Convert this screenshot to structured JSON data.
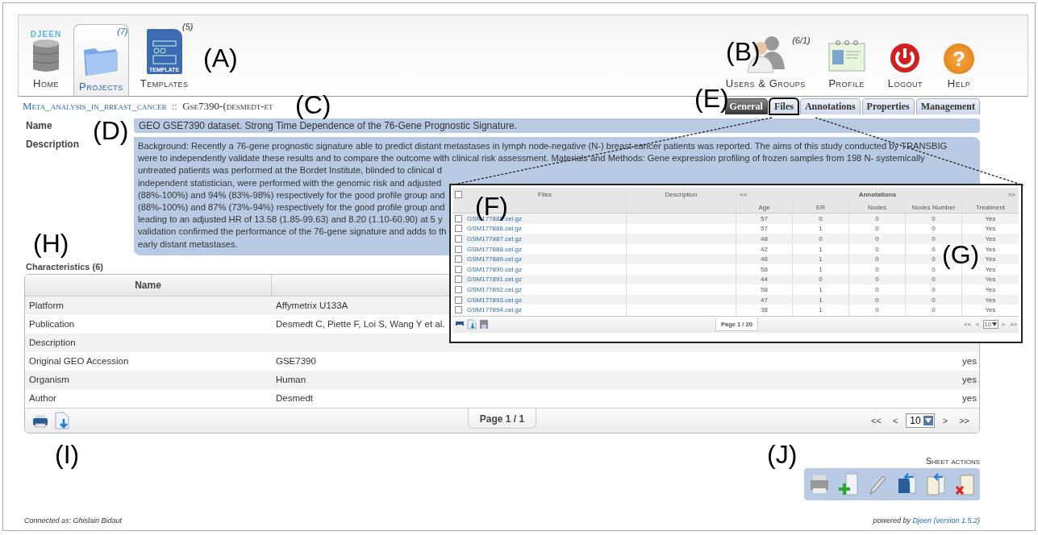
{
  "header": {
    "logo_text": "DJEEN",
    "left_nav": [
      {
        "kind": "home",
        "label": "Home",
        "selected": false
      },
      {
        "kind": "projects",
        "label": "Projects",
        "count": "(7)",
        "selected": true
      },
      {
        "kind": "templates",
        "label": "Templates",
        "count": "(5)",
        "icon_text": "TEMPLATE",
        "selected": false
      }
    ],
    "right_nav": [
      {
        "kind": "users",
        "label": "Users & Groups",
        "count": "(6/1)"
      },
      {
        "kind": "profile",
        "label": "Profile"
      },
      {
        "kind": "logout",
        "label": "Logout"
      },
      {
        "kind": "help",
        "label": "Help",
        "icon_glyph": "?"
      }
    ]
  },
  "breadcrumb": {
    "project": "Meta_analysis_in_breast_cancer",
    "separator": "::",
    "dataset": "Gse7390-(desmedt-et"
  },
  "tabs": [
    {
      "label": "General",
      "selected": true,
      "highlighted": false
    },
    {
      "label": "Files",
      "selected": false,
      "highlighted": true
    },
    {
      "label": "Annotations",
      "selected": false,
      "highlighted": false
    },
    {
      "label": "Properties",
      "selected": false,
      "highlighted": false
    },
    {
      "label": "Management",
      "selected": false,
      "highlighted": false
    }
  ],
  "fields": [
    {
      "kind": "single",
      "label": "Name",
      "value": "GEO GSE7390 dataset. Strong Time Dependence of the 76-Gene Prognostic Signature."
    },
    {
      "kind": "multi",
      "label": "Description",
      "lines": [
        "Background: Recently a 76-gene prognostic signature able to predict distant metastases in lymph node-negative (N-) breast cancer patients was reported. The aims of this study conducted by TRANSBIG",
        "were to independently validate these results and to compare the outcome with clinical risk assessment. Materials and Methods: Gene expression profiling of frozen samples from 198 N- systemically",
        "untreated patients was performed at the Bordet Institute, blinded to clinical d",
        "independent statistician, were performed with the genomic risk and adjusted",
        "(88%-100%) and 94% (83%-98%) respectively for the good profile group and",
        "(88%-100%) and 87% (73%-94%) respectively for the good profile group and",
        "leading to an adjusted HR of 13.58 (1.85-99.63) and 8.20 (1.10-60.90) at 5 y",
        "validation confirmed the performance of the 76-gene signature and adds to th",
        "early distant metastases."
      ]
    }
  ],
  "characteristics": {
    "title": "Characteristics (6)",
    "columns": [
      "Name"
    ],
    "rows": [
      {
        "name": "Platform",
        "value": "Affymetrix U133A"
      },
      {
        "name": "Publication",
        "value": "Desmedt C, Piette F, Loi S, Wang Y et al."
      },
      {
        "name": "Description"
      },
      {
        "name": "Original GEO Accession",
        "value": "GSE7390",
        "flag": "yes"
      },
      {
        "name": "Organism",
        "value": "Human",
        "flag": "yes"
      },
      {
        "name": "Author",
        "value": "Desmedt",
        "flag": "yes"
      }
    ],
    "footer": {
      "page": "Page 1 / 1",
      "first": "<<",
      "prev": "<",
      "page_size": "10",
      "next": ">",
      "last": ">>"
    }
  },
  "files_panel": {
    "all_checked": false,
    "headers": {
      "files": "Files",
      "description": "Description",
      "prev": "<<",
      "group": "Annotations",
      "next": ">>"
    },
    "annotation_columns": [
      "Age",
      "ER",
      "Nodes",
      "Nodes Number",
      "Treatment"
    ],
    "rows": [
      {
        "file": "GSM177885.cel.gz",
        "checked": false,
        "values": [
          "57",
          "0",
          "0",
          "0",
          "Yes"
        ]
      },
      {
        "file": "GSM177886.cel.gz",
        "checked": false,
        "values": [
          "57",
          "1",
          "0",
          "0",
          "Yes"
        ]
      },
      {
        "file": "GSM177887.cel.gz",
        "checked": false,
        "values": [
          "48",
          "0",
          "0",
          "0",
          "Yes"
        ]
      },
      {
        "file": "GSM177888.cel.gz",
        "checked": false,
        "values": [
          "42",
          "1",
          "0",
          "0",
          "Yes"
        ]
      },
      {
        "file": "GSM177889.cel.gz",
        "checked": false,
        "values": [
          "46",
          "1",
          "0",
          "0",
          "Yes"
        ]
      },
      {
        "file": "GSM177890.cel.gz",
        "checked": false,
        "values": [
          "58",
          "1",
          "0",
          "0",
          "Yes"
        ]
      },
      {
        "file": "GSM177891.cel.gz",
        "checked": false,
        "values": [
          "44",
          "0",
          "0",
          "0",
          "Yes"
        ]
      },
      {
        "file": "GSM177892.cel.gz",
        "checked": false,
        "values": [
          "58",
          "1",
          "0",
          "0",
          "Yes"
        ]
      },
      {
        "file": "GSM177893.cel.gz",
        "checked": false,
        "values": [
          "47",
          "1",
          "0",
          "0",
          "Yes"
        ]
      },
      {
        "file": "GSM177894.cel.gz",
        "checked": false,
        "values": [
          "38",
          "1",
          "0",
          "0",
          "Yes"
        ]
      }
    ],
    "footer": {
      "page": "Page 1 / 20",
      "first": "<<",
      "prev": "<",
      "page_size": "10",
      "next": ">",
      "last": ">>"
    }
  },
  "sheet_actions": {
    "title": "Sheet actions",
    "actions": [
      {
        "kind": "print"
      },
      {
        "kind": "add"
      },
      {
        "kind": "edit"
      },
      {
        "kind": "import"
      },
      {
        "kind": "paste"
      },
      {
        "kind": "delete"
      }
    ]
  },
  "footer": {
    "connected": "Connected as: Ghislain Bidaut",
    "powered_prefix": "powered by",
    "powered_link": "Djeen (version 1.5.2)"
  },
  "callouts": [
    "(A)",
    "(B)",
    "(C)",
    "(D)",
    "(E)",
    "(F)",
    "(G)",
    "(H)",
    "(I)",
    "(J)"
  ]
}
